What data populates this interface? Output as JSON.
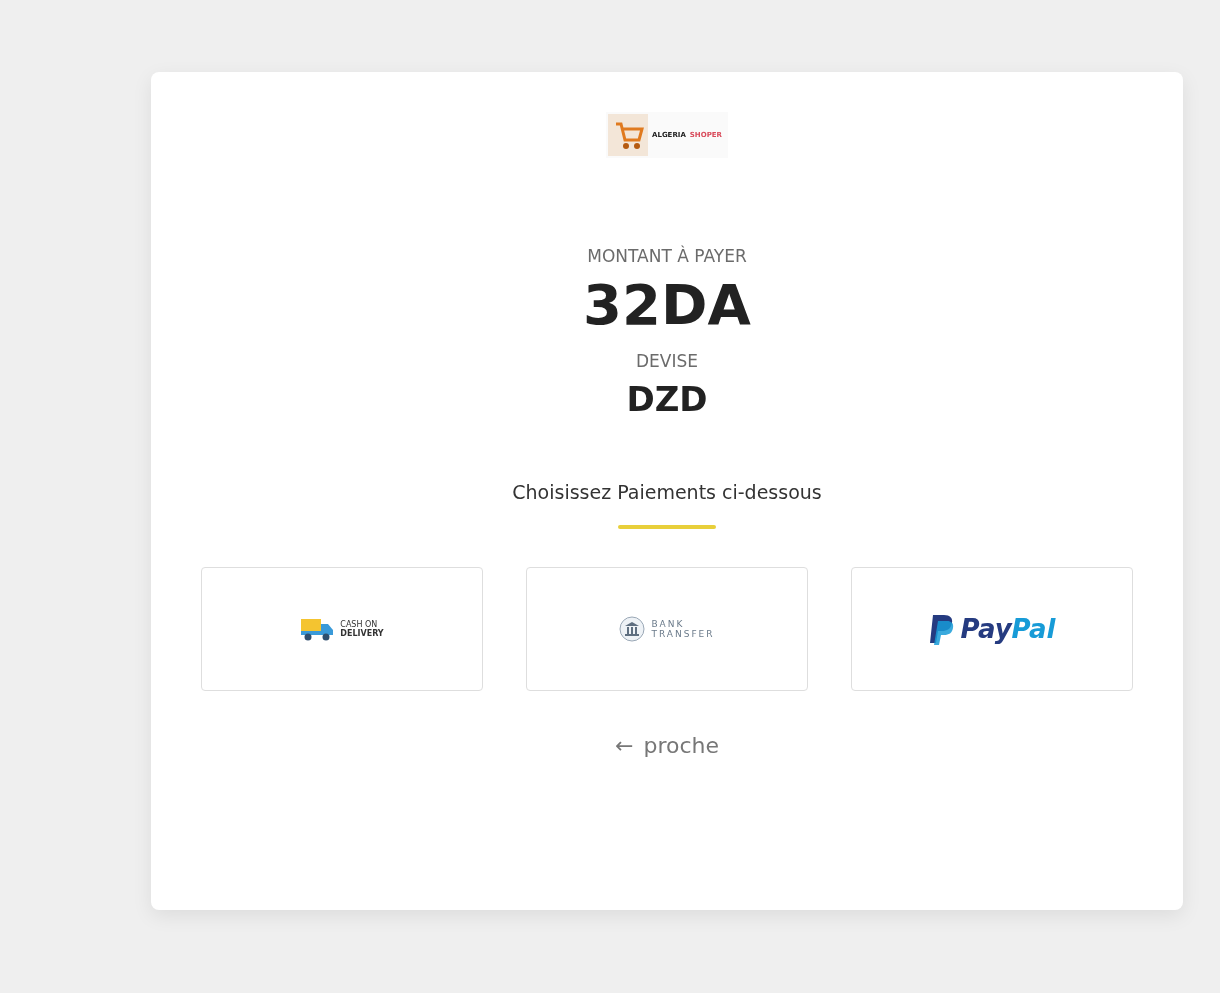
{
  "logo": {
    "words": [
      "ALGERIA",
      "SHOPER"
    ]
  },
  "amount": {
    "label": "MONTANT À PAYER",
    "value": "32DA"
  },
  "currency": {
    "label": "DEVISE",
    "value": "DZD"
  },
  "choose_heading": "Choisissez Paiements ci-dessous",
  "methods": [
    {
      "kind": "cash",
      "lines": [
        "CASH ON",
        "DELIVERY"
      ]
    },
    {
      "kind": "bank",
      "lines": [
        "BANK",
        "TRANSFER"
      ]
    },
    {
      "kind": "paypal",
      "lines": [
        "Pay",
        "Pal"
      ]
    }
  ],
  "back_link": {
    "arrow": "←",
    "label": "proche"
  }
}
